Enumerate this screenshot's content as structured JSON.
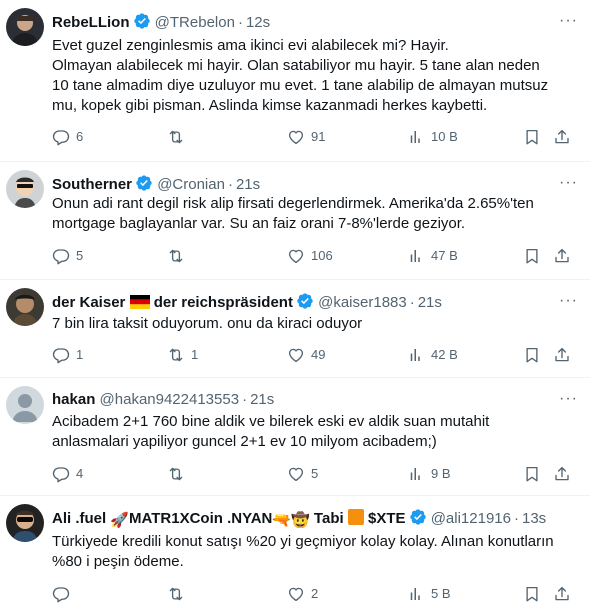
{
  "tweets": [
    {
      "name": "RebeLLion",
      "handle": "@TRebelon",
      "time": "12s",
      "lines": [
        "Evet guzel zenginlesmis ama ikinci evi alabilecek mi? Hayir.",
        "Olmayan alabilecek mi hayir. Olan satabiliyor mu hayir. 5 tane alan neden",
        "10 tane almadim diye uzuluyor mu evet. 1 tane alabilip de almayan mutsuz",
        "mu, kopek gibi pisman. Aslinda kimse kazanmadi herkes kaybetti."
      ],
      "replies": "6",
      "retweets": "",
      "likes": "91",
      "views": "10 B"
    },
    {
      "name": "Southerner",
      "handle": "@Cronian",
      "time": "21s",
      "lines": [
        "Onun adi rant degil risk alip firsati degerlendirmek. Amerika'da 2.65%'ten",
        "mortgage baglayanlar var. Su an faiz orani 7-8%'lerde geziyor."
      ],
      "replies": "5",
      "retweets": "",
      "likes": "106",
      "views": "47 B"
    },
    {
      "name_part1": "der Kaiser",
      "name_part2": "der reichspräsident",
      "handle": "@kaiser1883",
      "time": "21s",
      "lines": [
        "7 bin lira taksit oduyorum. onu da kiraci oduyor"
      ],
      "replies": "1",
      "retweets": "1",
      "likes": "49",
      "views": "42 B"
    },
    {
      "name": "hakan",
      "handle": "@hakan9422413553",
      "time": "21s",
      "lines": [
        "Acibadem 2+1 760 bine aldik ve bilerek eski ev aldik suan mutahit",
        "anlasmalari yapiliyor guncel 2+1 ev 10 milyom acibadem;)"
      ],
      "replies": "4",
      "retweets": "",
      "likes": "5",
      "views": "9 B"
    },
    {
      "name_part1": "Ali .fuel",
      "name_part2": "MATR1XCoin .NYAN",
      "name_part3": "Tabi",
      "name_part4": "$XTE",
      "handle": "@ali121916",
      "time": "13s",
      "lines": [
        "Türkiyede kredili konut satışı %20 yi geçmiyor kolay kolay. Alınan konutların",
        "%80 i peşin ödeme."
      ],
      "replies": "",
      "retweets": "",
      "likes": "2",
      "views": "5 B"
    }
  ],
  "colors": {
    "verified": "#1d9bf0",
    "muted": "#536471",
    "text": "#0f1419",
    "divider": "#eff3f4"
  },
  "icons": {
    "reply": "reply-icon",
    "retweet": "retweet-icon",
    "like": "heart-icon",
    "views": "views-icon",
    "bookmark": "bookmark-icon",
    "share": "share-icon"
  }
}
